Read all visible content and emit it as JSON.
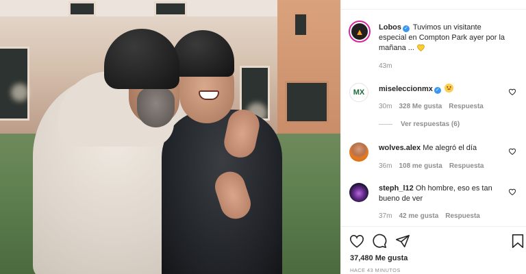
{
  "post": {
    "author": "Lobos",
    "caption": "Tuvimos un visitante especial en Compton Park ayer por la mañana ...",
    "time": "43m",
    "likes": "37,480 Me gusta",
    "posted_ago": "HACE 43 MINUTOS"
  },
  "comments": [
    {
      "username": "miseleccionmx",
      "verified": true,
      "text": "",
      "emoji": "grinning",
      "time": "30m",
      "likes": "328 Me gusta",
      "reply_label": "Respuesta"
    },
    {
      "username": "wolves.alex",
      "verified": false,
      "text": "Me alegró el día",
      "time": "36m",
      "likes": "108 me gusta",
      "reply_label": "Respuesta"
    },
    {
      "username": "steph_l12",
      "verified": false,
      "text": "Oh hombre, eso es tan bueno de ver",
      "time": "37m",
      "likes": "42 me gusta",
      "reply_label": "Respuesta"
    }
  ],
  "view_replies": "Ver respuestas (6)",
  "icons": {
    "like": "heart-icon",
    "comment": "comment-icon",
    "share": "paper-plane-icon",
    "save": "bookmark-icon"
  },
  "colors": {
    "verified": "#3897f0",
    "meta": "#8e8e8e",
    "text": "#262626",
    "ring": "#d6249f"
  }
}
